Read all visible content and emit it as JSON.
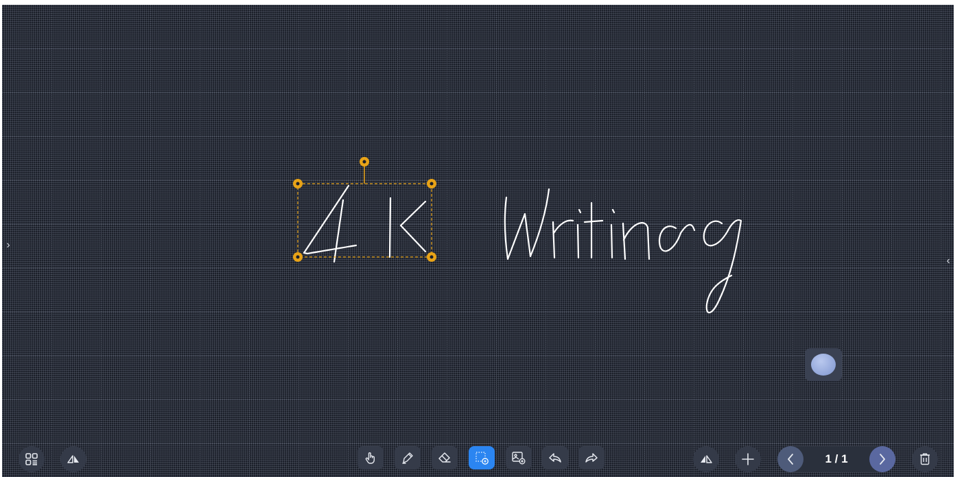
{
  "left_panel": {
    "toggle_glyph": "›",
    "icon": "chevron-right-icon"
  },
  "right_panel": {
    "toggle_glyph": "‹",
    "icon": "chevron-left-icon"
  },
  "canvas": {
    "handwriting_strokes": [
      "4",
      "K",
      "Writing"
    ],
    "background": "#1b1f29",
    "selection_color": "#e8a317",
    "ink_color": "#ffffff"
  },
  "floating_ball": {
    "color": "#9fb3e6"
  },
  "bottom_left": {
    "buttons": [
      {
        "name": "apps-menu",
        "icon": "apps-grid-icon"
      },
      {
        "name": "switch-side",
        "icon": "flip-toolbar-icon"
      }
    ]
  },
  "toolbar": {
    "tools": [
      {
        "name": "hand",
        "icon": "hand-pointer-icon",
        "active": false
      },
      {
        "name": "pen",
        "icon": "pen-icon",
        "active": false
      },
      {
        "name": "eraser",
        "icon": "eraser-icon",
        "active": false
      },
      {
        "name": "select",
        "icon": "lasso-select-icon",
        "active": true
      },
      {
        "name": "insert-image",
        "icon": "image-insert-icon",
        "active": false
      },
      {
        "name": "undo",
        "icon": "undo-icon",
        "active": false
      },
      {
        "name": "redo",
        "icon": "redo-icon",
        "active": false
      }
    ],
    "active_color": "#2b85f1"
  },
  "bottom_right": {
    "flip_icon": "flip-toolbar-icon",
    "add_page_icon": "plus-icon",
    "pager": {
      "label": "1 / 1",
      "prev_icon": "chevron-left-icon",
      "next_icon": "chevron-right-icon"
    },
    "delete_icon": "trash-icon"
  }
}
